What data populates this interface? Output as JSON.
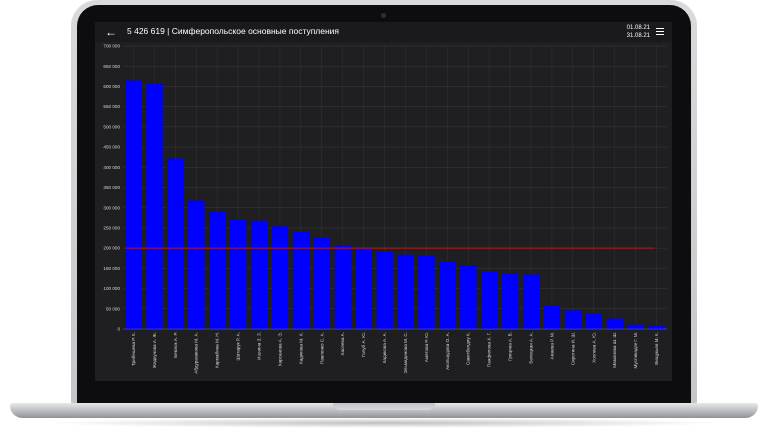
{
  "header": {
    "back_icon": "arrow-left-icon",
    "title": "5 426 619 | Симферопольское основные поступления",
    "date_from": "01.08.21",
    "date_to": "31.08.21",
    "menu_icon": "hamburger-menu-icon"
  },
  "colors": {
    "bar": "#0000ff",
    "reference_line": "#c01818",
    "background": "#1f1f21",
    "grid": "#3a3a3d"
  },
  "chart_data": {
    "type": "bar",
    "categories": [
      "Трибешева Р. К.",
      "Жидкунова А. Ж.",
      "Бевзюк А. Р.",
      "Абдуразакова М. А.",
      "Кармабина М. Н.",
      "Шатарук Р. А.",
      "Ишнина З. З.",
      "Карсанова А. Э.",
      "Кадикова М. Х.",
      "Павленко С. А.",
      "Хасеева А.",
      "Голуб А. Ю.",
      "Кадикова А. А.",
      "Эльмидинова М. С.",
      "Аметова Р. Ю.",
      "Акопшудова О. А.",
      "Сакетбелдиу К.",
      "Панфилова Х. Г.",
      "Грицина А. В.",
      "Белецкая А. А.",
      "Амаева Р. М.",
      "Сиротина И. Ш.",
      "Хохлева А. Ю.",
      "Мамонова Ш. Ш.",
      "Мусликадзе Г. М.",
      "Вищукьев М. К."
    ],
    "values": [
      615000,
      608000,
      422000,
      318000,
      290000,
      270000,
      268000,
      254000,
      240000,
      226000,
      206000,
      200000,
      192000,
      184000,
      182000,
      167000,
      156000,
      142000,
      137000,
      135000,
      57000,
      46000,
      37000,
      26000,
      11000,
      8000
    ],
    "reference_line": 200000,
    "ylim": [
      0,
      700000
    ],
    "yticks": [
      "0",
      "50 000",
      "100 000",
      "150 000",
      "200 000",
      "250 000",
      "300 000",
      "350 000",
      "400 000",
      "450 000",
      "500 000",
      "550 000",
      "600 000",
      "650 000",
      "700 000"
    ],
    "grid": true,
    "title": "",
    "xlabel": "",
    "ylabel": ""
  }
}
